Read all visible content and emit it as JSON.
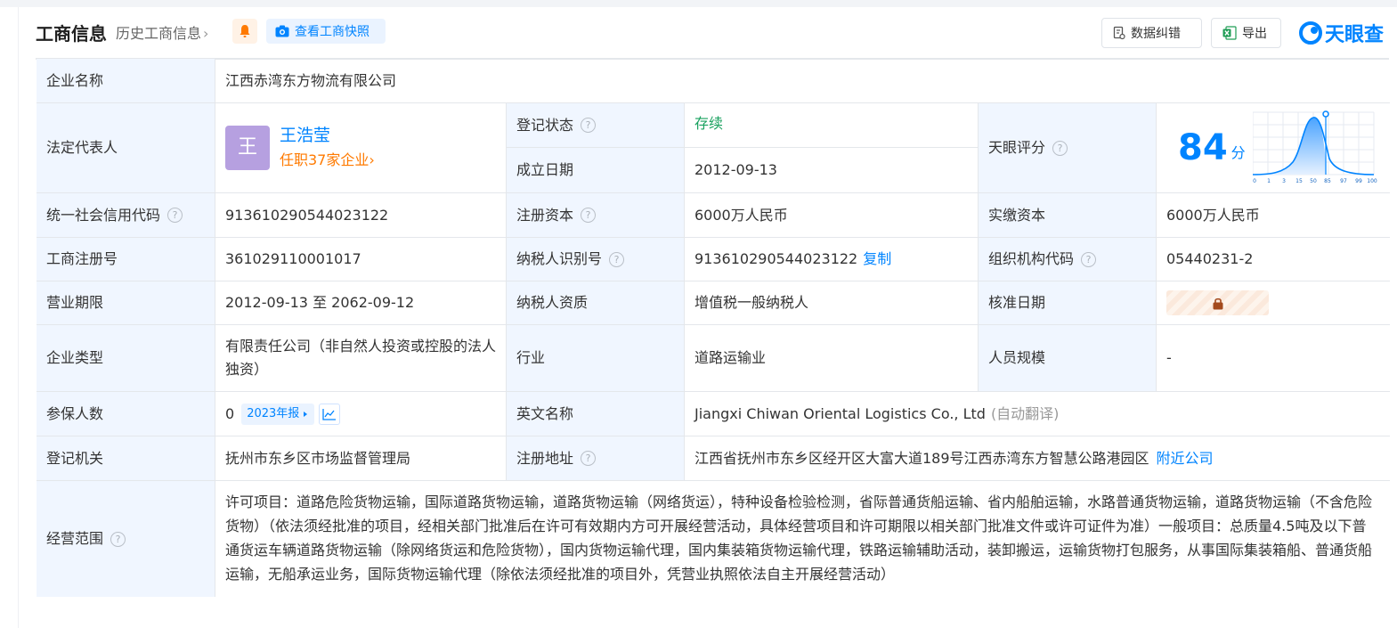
{
  "header": {
    "title": "工商信息",
    "history": "历史工商信息",
    "history_chevron": "›",
    "snapshot": "查看工商快照",
    "data_fix": "数据纠错",
    "export": "导出",
    "logo_text": "天眼查"
  },
  "labels": {
    "company_name": "企业名称",
    "legal_rep": "法定代表人",
    "reg_status": "登记状态",
    "est_date": "成立日期",
    "tianyan_score": "天眼评分",
    "credit_code": "统一社会信用代码",
    "reg_capital": "注册资本",
    "paid_capital": "实缴资本",
    "biz_reg_no": "工商注册号",
    "taxpayer_id": "纳税人识别号",
    "org_code": "组织机构代码",
    "biz_term": "营业期限",
    "taxpayer_qual": "纳税人资质",
    "approval_date": "核准日期",
    "company_type": "企业类型",
    "industry": "行业",
    "staff_size": "人员规模",
    "insured_count": "参保人数",
    "english_name": "英文名称",
    "reg_authority": "登记机关",
    "reg_address": "注册地址",
    "biz_scope": "经营范围"
  },
  "values": {
    "company_name": "江西赤湾东方物流有限公司",
    "rep_avatar": "王",
    "rep_name": "王浩莹",
    "rep_sub": "任职37家企业",
    "rep_sub_chevron": "›",
    "reg_status": "存续",
    "est_date": "2012-09-13",
    "score": "84",
    "score_unit": "分",
    "score_axis": [
      "0",
      "1",
      "3",
      "15",
      "50",
      "85",
      "97",
      "99",
      "100"
    ],
    "credit_code": "913610290544023122",
    "reg_capital": "6000万人民币",
    "paid_capital": "6000万人民币",
    "biz_reg_no": "361029110001017",
    "taxpayer_id": "913610290544023122",
    "copy": "复制",
    "org_code": "05440231-2",
    "biz_term": "2012-09-13 至 2062-09-12",
    "taxpayer_qual": "增值税一般纳税人",
    "company_type": "有限责任公司（非自然人投资或控股的法人独资）",
    "industry": "道路运输业",
    "staff_size": "-",
    "insured_count": "0",
    "report_year": "2023年报",
    "english_name": "Jiangxi Chiwan Oriental Logistics Co., Ltd",
    "auto_translate": "(自动翻译)",
    "reg_authority": "抚州市东乡区市场监督管理局",
    "reg_address": "江西省抚州市东乡区经开区大富大道189号江西赤湾东方智慧公路港园区",
    "nearby": "附近公司",
    "biz_scope": "许可项目：道路危险货物运输，国际道路货物运输，道路货物运输（网络货运），特种设备检验检测，省际普通货船运输、省内船舶运输，水路普通货物运输，道路货物运输（不含危险货物）（依法须经批准的项目，经相关部门批准后在许可有效期内方可开展经营活动，具体经营项目和许可期限以相关部门批准文件或许可证件为准）一般项目：总质量4.5吨及以下普通货运车辆道路货物运输（除网络货运和危险货物），国内货物运输代理，国内集装箱货物运输代理，铁路运输辅助活动，装卸搬运，运输货物打包服务，从事国际集装箱船、普通货船运输，无船承运业务，国际货物运输代理（除依法须经批准的项目外，凭营业执照依法自主开展经营活动）"
  },
  "colors": {
    "accent": "#0084ff",
    "label_bg": "#f0f6ff",
    "status_green": "#19a15f",
    "orange": "#ff7a00"
  }
}
